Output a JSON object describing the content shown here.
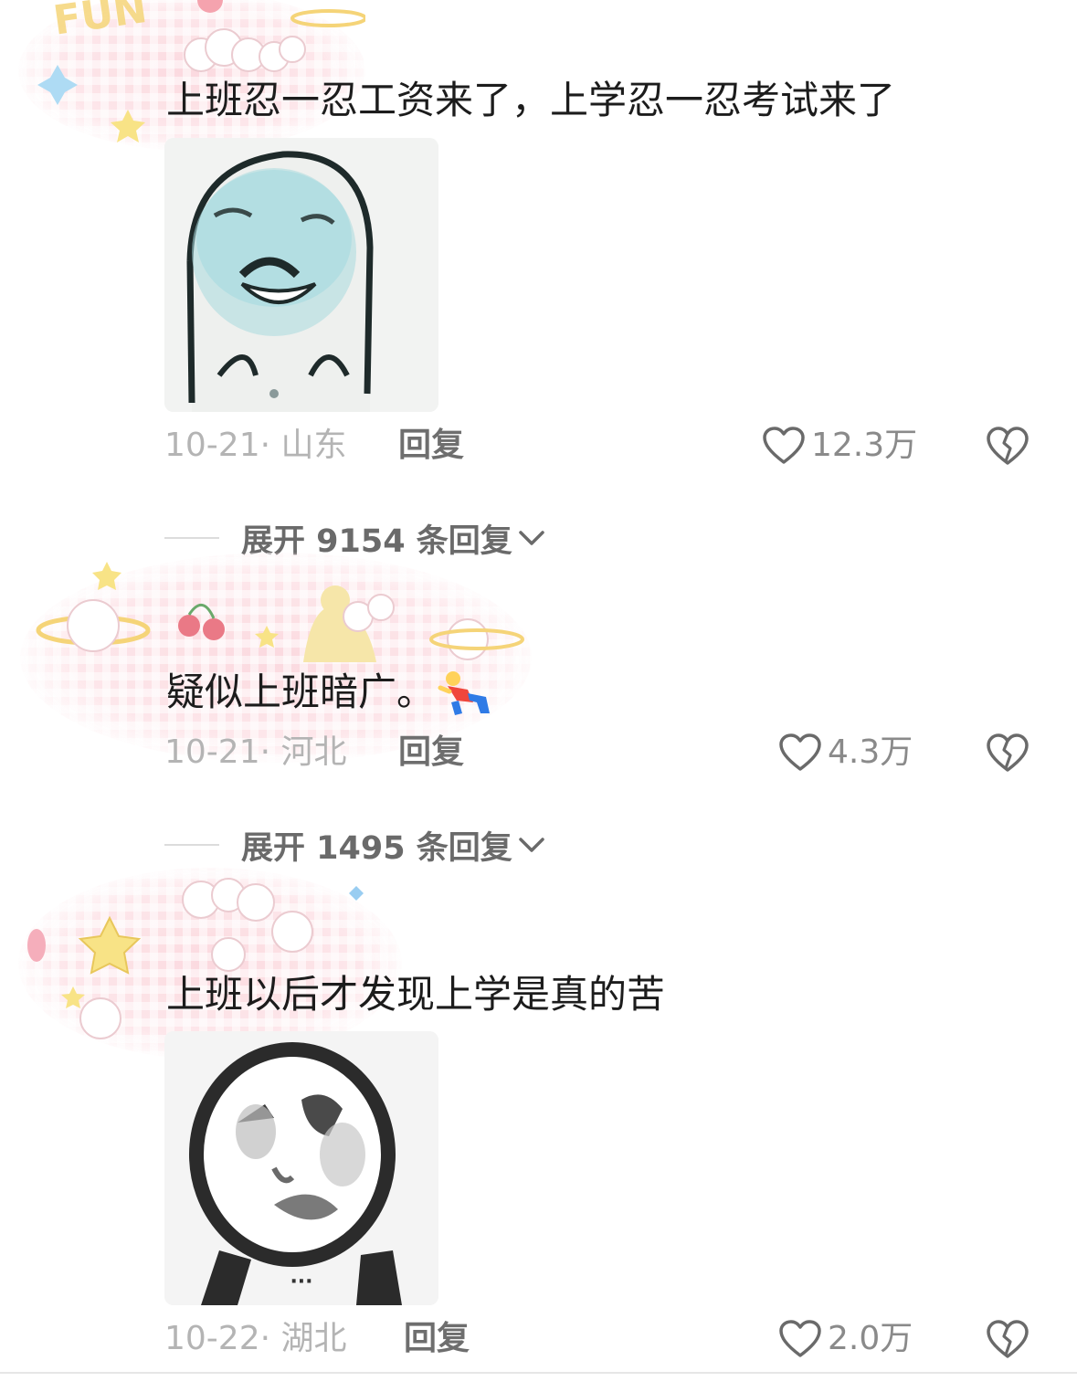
{
  "comments": [
    {
      "text": "上班忍一忍工资来了，上学忍一忍考试来了",
      "has_image": true,
      "image_icon": "meme-sticker-blue-face",
      "date_location": "10-21· 山东",
      "reply_label": "回复",
      "like_count": "12.3万",
      "expand_label": "展开 9154 条回复"
    },
    {
      "text": "疑似上班暗广。",
      "emoji_icon": "fallen-person-emoji",
      "date_location": "10-21· 河北",
      "reply_label": "回复",
      "like_count": "4.3万",
      "expand_label": "展开 1495 条回复"
    },
    {
      "text": "上班以后才发现上学是真的苦",
      "has_image": true,
      "image_icon": "meme-sticker-gray-face",
      "image_badge": "···",
      "date_location": "10-22· 湖北",
      "reply_label": "回复",
      "like_count": "2.0万"
    }
  ],
  "icons": {
    "like": "heart-outline-icon",
    "dislike": "broken-heart-icon",
    "expand": "chevron-down-icon"
  },
  "colors": {
    "text": "#1c1c1c",
    "meta": "#b4b4b4",
    "reply": "#6e6e6e",
    "like": "#8a8a8a",
    "avatar_decoration": "#fbd6dc"
  }
}
